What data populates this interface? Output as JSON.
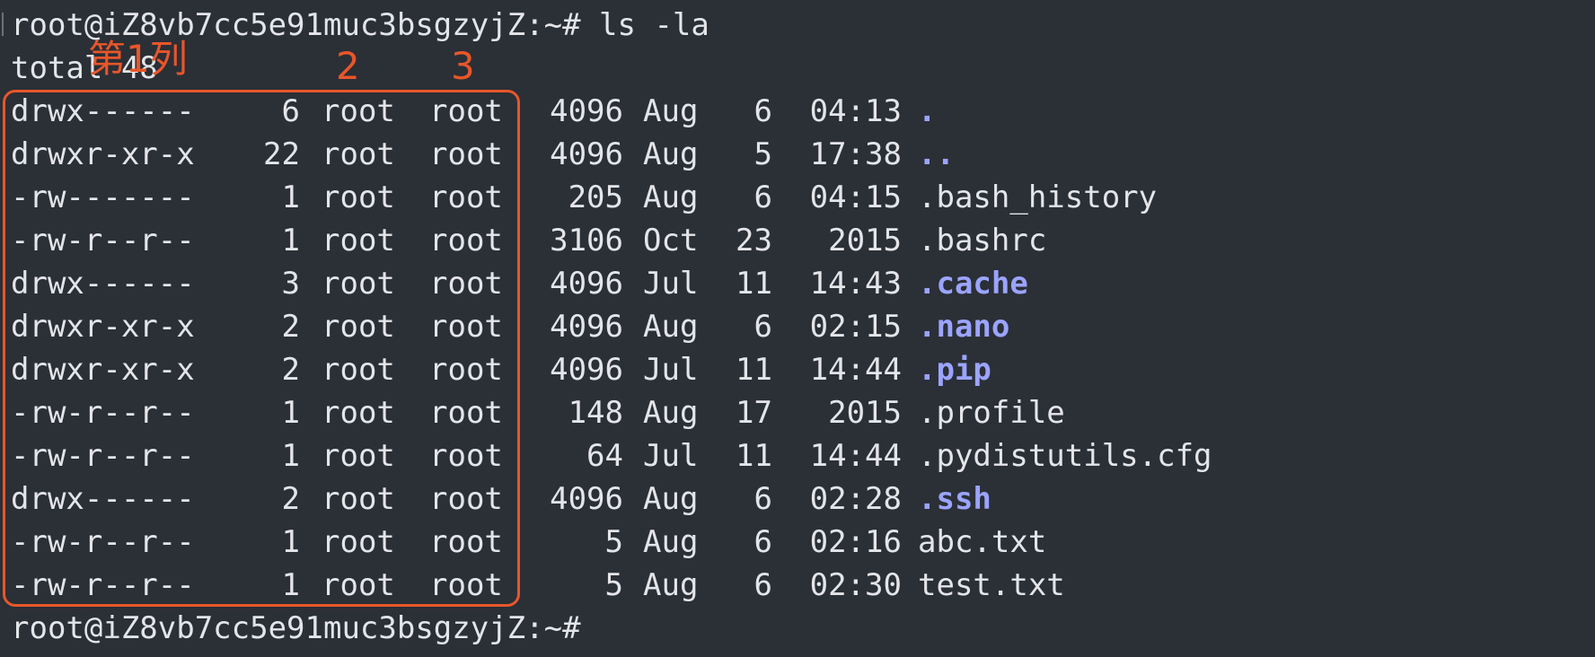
{
  "terminal": {
    "prompt_top": "root@iZ8vb7cc5e91muc3bsgzyjZ:~# ls -la",
    "total_line": "total 48",
    "prompt_bottom": "root@iZ8vb7cc5e91muc3bsgzyjZ:~#",
    "entries": [
      {
        "perm": "drwx------",
        "links": "6",
        "owner": "root",
        "group": "root",
        "size": "4096",
        "month": "Aug",
        "day": "6",
        "time": "04:13",
        "name": ".",
        "is_dir": true
      },
      {
        "perm": "drwxr-xr-x",
        "links": "22",
        "owner": "root",
        "group": "root",
        "size": "4096",
        "month": "Aug",
        "day": "5",
        "time": "17:38",
        "name": "..",
        "is_dir": true
      },
      {
        "perm": "-rw-------",
        "links": "1",
        "owner": "root",
        "group": "root",
        "size": "205",
        "month": "Aug",
        "day": "6",
        "time": "04:15",
        "name": ".bash_history",
        "is_dir": false
      },
      {
        "perm": "-rw-r--r--",
        "links": "1",
        "owner": "root",
        "group": "root",
        "size": "3106",
        "month": "Oct",
        "day": "23",
        "time": "2015",
        "name": ".bashrc",
        "is_dir": false
      },
      {
        "perm": "drwx------",
        "links": "3",
        "owner": "root",
        "group": "root",
        "size": "4096",
        "month": "Jul",
        "day": "11",
        "time": "14:43",
        "name": ".cache",
        "is_dir": true
      },
      {
        "perm": "drwxr-xr-x",
        "links": "2",
        "owner": "root",
        "group": "root",
        "size": "4096",
        "month": "Aug",
        "day": "6",
        "time": "02:15",
        "name": ".nano",
        "is_dir": true
      },
      {
        "perm": "drwxr-xr-x",
        "links": "2",
        "owner": "root",
        "group": "root",
        "size": "4096",
        "month": "Jul",
        "day": "11",
        "time": "14:44",
        "name": ".pip",
        "is_dir": true
      },
      {
        "perm": "-rw-r--r--",
        "links": "1",
        "owner": "root",
        "group": "root",
        "size": "148",
        "month": "Aug",
        "day": "17",
        "time": "2015",
        "name": ".profile",
        "is_dir": false
      },
      {
        "perm": "-rw-r--r--",
        "links": "1",
        "owner": "root",
        "group": "root",
        "size": "64",
        "month": "Jul",
        "day": "11",
        "time": "14:44",
        "name": ".pydistutils.cfg",
        "is_dir": false
      },
      {
        "perm": "drwx------",
        "links": "2",
        "owner": "root",
        "group": "root",
        "size": "4096",
        "month": "Aug",
        "day": "6",
        "time": "02:28",
        "name": ".ssh",
        "is_dir": true
      },
      {
        "perm": "-rw-r--r--",
        "links": "1",
        "owner": "root",
        "group": "root",
        "size": "5",
        "month": "Aug",
        "day": "6",
        "time": "02:16",
        "name": "abc.txt",
        "is_dir": false
      },
      {
        "perm": "-rw-r--r--",
        "links": "1",
        "owner": "root",
        "group": "root",
        "size": "5",
        "month": "Aug",
        "day": "6",
        "time": "02:30",
        "name": "test.txt",
        "is_dir": false
      }
    ]
  },
  "annotations": {
    "col1": "第1列",
    "col2": "2",
    "col3": "3"
  },
  "colors": {
    "background": "#2b2f36",
    "text": "#e3e5e8",
    "directory": "#9ba4ff",
    "annotation": "#e8562a"
  }
}
